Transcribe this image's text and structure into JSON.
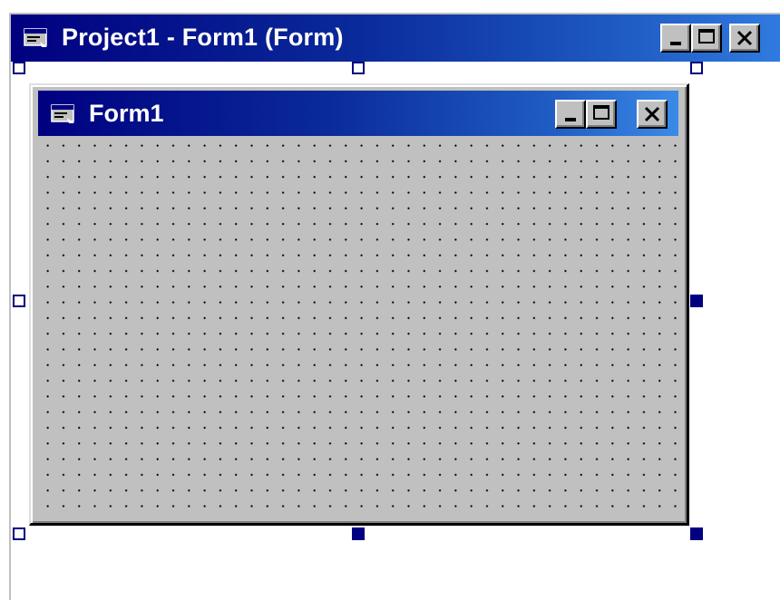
{
  "outer_window": {
    "title": "Project1 - Form1 (Form)",
    "icon": "form-icon",
    "buttons": [
      "minimize",
      "maximize",
      "close"
    ]
  },
  "form": {
    "title": "Form1",
    "icon": "form-icon",
    "buttons": [
      "minimize",
      "maximize",
      "close"
    ],
    "grid_visible": true
  },
  "colors": {
    "titlebar_start": "#000080",
    "titlebar_end": "#2f7ae0",
    "form_background": "#c0c0c0",
    "handle": "#000080"
  }
}
